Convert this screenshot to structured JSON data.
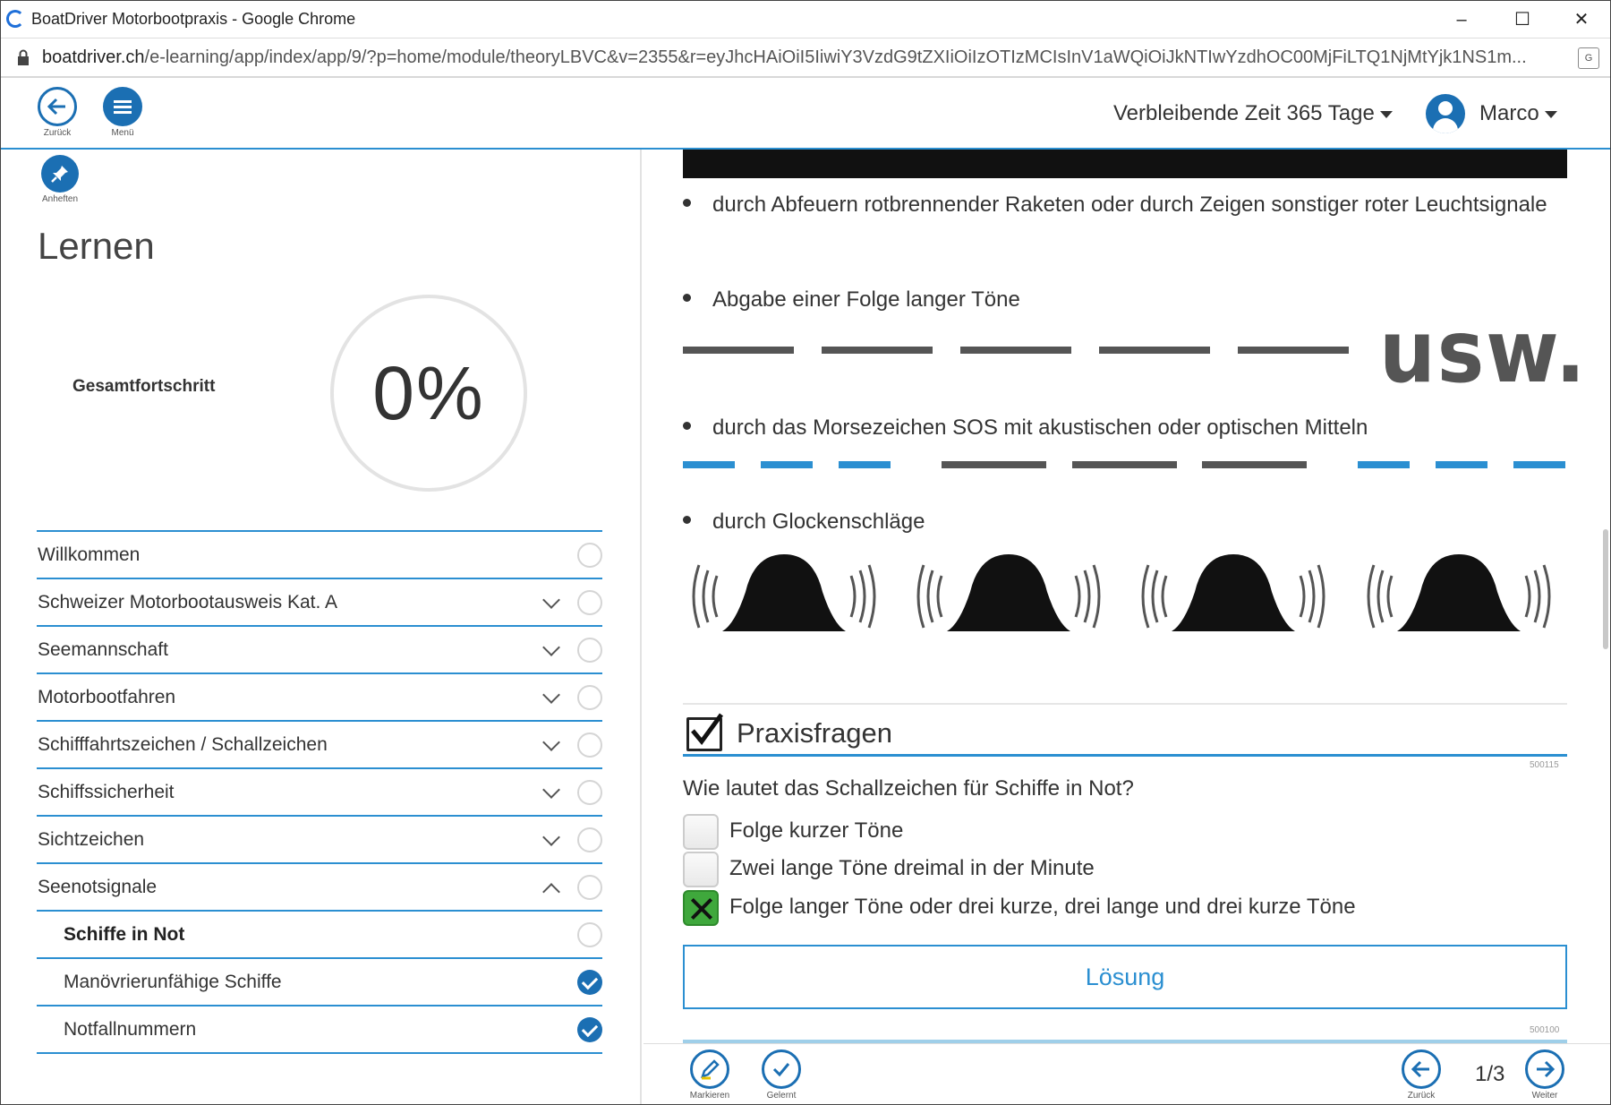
{
  "window": {
    "title": "BoatDriver Motorbootpraxis - Google Chrome",
    "minimize": "–",
    "maximize": "☐",
    "close": "✕"
  },
  "address": {
    "host": "boatdriver.ch",
    "path": "/e-learning/app/index/app/9/?p=home/module/theoryLBVC&v=2355&r=eyJhcHAiOiI5IiwiY3VzdG9tZXIiOiIzOTIzMCIsInV1aWQiOiJkNTIwYzdhOC00MjFiLTQ1NjMtYjk1NS1m..."
  },
  "header": {
    "back_label": "Zurück",
    "menu_label": "Menü",
    "time_remaining": "Verbleibende Zeit 365 Tage",
    "user_name": "Marco"
  },
  "sidebar": {
    "pin_label": "Anheften",
    "title": "Lernen",
    "progress_label": "Gesamtfortschritt",
    "progress_value": "0%",
    "progress_fraction": 0,
    "items": [
      {
        "label": "Willkommen",
        "expandable": false,
        "done": false
      },
      {
        "label": "Schweizer Motorbootausweis Kat. A",
        "expandable": true,
        "done": false
      },
      {
        "label": "Seemannschaft",
        "expandable": true,
        "done": false
      },
      {
        "label": "Motorbootfahren",
        "expandable": true,
        "done": false
      },
      {
        "label": "Schifffahrtszeichen / Schallzeichen",
        "expandable": true,
        "done": false
      },
      {
        "label": "Schiffssicherheit",
        "expandable": true,
        "done": false
      },
      {
        "label": "Sichtzeichen",
        "expandable": true,
        "done": false
      },
      {
        "label": "Seenotsignale",
        "expandable": true,
        "expanded": true,
        "done": false
      },
      {
        "label": "Schiffe in Not",
        "sub": true,
        "active": true,
        "done": false
      },
      {
        "label": "Manövrierunfähige Schiffe",
        "sub": true,
        "done": true
      },
      {
        "label": "Notfallnummern",
        "sub": true,
        "done": true
      }
    ]
  },
  "content": {
    "bullets": [
      "durch Abfeuern rotbrennender Raketen oder durch Zeigen sonstiger roter Leuchtsignale",
      "Abgabe einer Folge langer Töne",
      "durch das Morsezeichen SOS mit akustischen oder optischen Mitteln",
      "durch Glockenschläge"
    ],
    "usw": "usw.",
    "colors": {
      "accent": "#2b8fd1",
      "dark_dash": "#555555",
      "correct": "#3fa83c"
    }
  },
  "praxis": {
    "title": "Praxisfragen",
    "question_id": "500115",
    "question": "Wie lautet das Schallzeichen für Schiffe in Not?",
    "answers": [
      {
        "text": "Folge kurzer Töne",
        "correct": false
      },
      {
        "text": "Zwei lange Töne dreimal in der Minute",
        "correct": false
      },
      {
        "text": "Folge langer Töne oder drei kurze, drei lange und drei kurze Töne",
        "correct": true
      }
    ],
    "solution_button": "Lösung",
    "next_question_id": "500100"
  },
  "footer": {
    "mark_label": "Markieren",
    "learned_label": "Gelernt",
    "back_label": "Zurück",
    "next_label": "Weiter",
    "pager": "1/3"
  }
}
